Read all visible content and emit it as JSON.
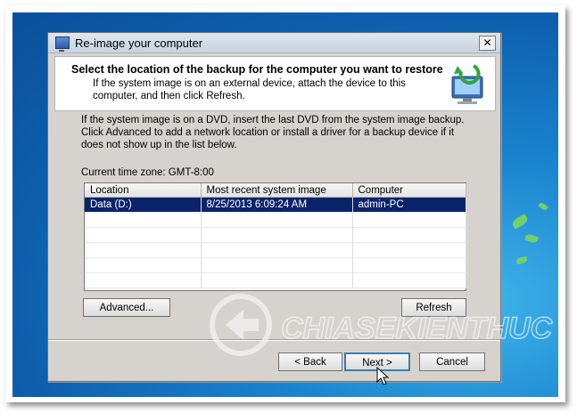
{
  "window": {
    "title": "Re-image your computer",
    "close_label": "✕"
  },
  "header": {
    "title": "Select the location of the backup for the computer you want to restore",
    "subtitle": "If the system image is on an external device, attach the device to this computer, and then click Refresh."
  },
  "info_text": "If the system image is on a DVD, insert the last DVD from the system image backup. Click Advanced to add a network location or install a driver for a backup device if it does not show up in the list below.",
  "time_zone": "Current time zone: GMT-8:00",
  "table": {
    "columns": [
      "Location",
      "Most recent system image",
      "Computer"
    ],
    "rows": [
      [
        "Data (D:)",
        "8/25/2013 6:09:24 AM",
        "admin-PC"
      ]
    ]
  },
  "buttons": {
    "advanced": "Advanced...",
    "refresh": "Refresh",
    "back": "< Back",
    "next": "Next >",
    "cancel": "Cancel"
  },
  "watermark": {
    "text": "CHIASEKIENTHUC"
  },
  "colors": {
    "selection": "#0a246a",
    "dialog_bg": "#d6d3ce",
    "desktop": "#1a84cf"
  },
  "icons": [
    "window-icon",
    "wizard-restore-icon",
    "close-icon",
    "mouse-cursor-icon"
  ]
}
